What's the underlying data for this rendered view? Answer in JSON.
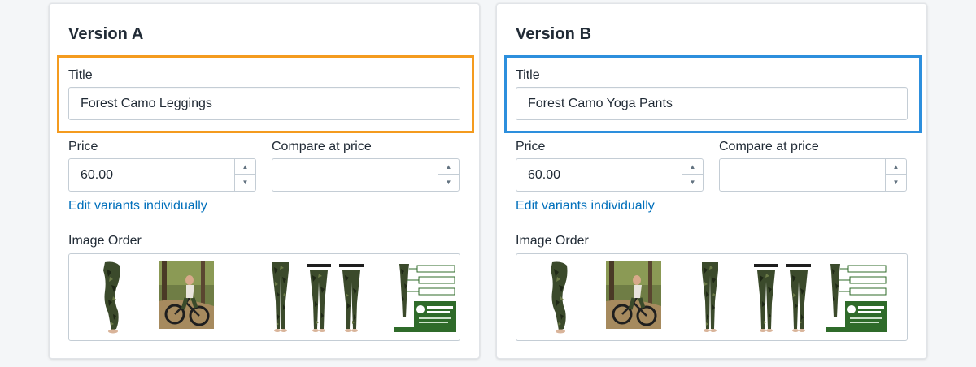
{
  "versions": [
    {
      "heading": "Version A",
      "highlight_color": "#f49b1f",
      "title_label": "Title",
      "title_value": "Forest Camo Leggings",
      "price_label": "Price",
      "price_value": "60.00",
      "compare_label": "Compare at price",
      "compare_value": "",
      "edit_variants_link": "Edit variants individually",
      "image_order_label": "Image Order",
      "images": [
        "leggings-side-image",
        "bike-rider-photo",
        "leggings-front-image",
        "leggings-pair-image",
        "tree-tribe-infographic"
      ]
    },
    {
      "heading": "Version B",
      "highlight_color": "#2d8fdd",
      "title_label": "Title",
      "title_value": "Forest Camo Yoga Pants",
      "price_label": "Price",
      "price_value": "60.00",
      "compare_label": "Compare at price",
      "compare_value": "",
      "edit_variants_link": "Edit variants individually",
      "image_order_label": "Image Order",
      "images": [
        "leggings-side-image",
        "bike-rider-photo",
        "leggings-front-image",
        "leggings-pair-image",
        "tree-tribe-infographic"
      ]
    }
  ],
  "colors": {
    "link": "#006fbb",
    "camo_dark": "#2f3a22",
    "camo_mid": "#4b5a34",
    "brand_green": "#2f6b2a"
  },
  "icons": {
    "step_up": "▲",
    "step_down": "▼"
  }
}
